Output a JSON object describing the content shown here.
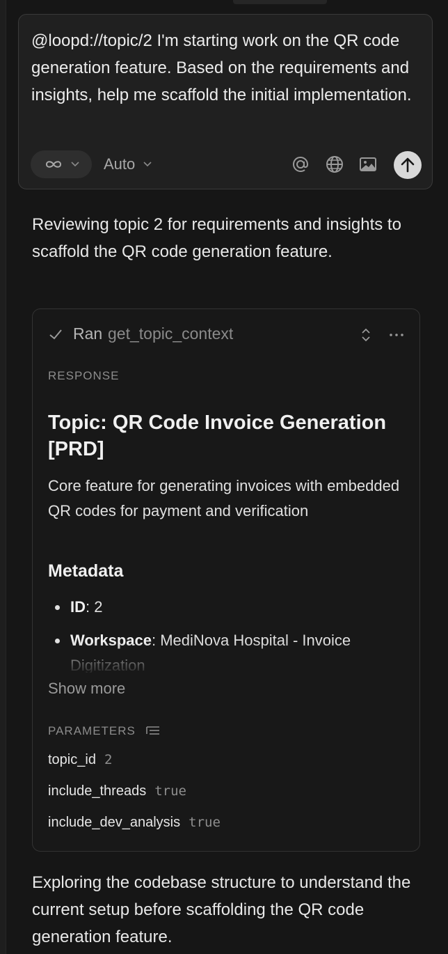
{
  "composer": {
    "message": "@loopd://topic/2 I'm starting work on the QR code generation feature. Based on the requirements and insights, help me scaffold the initial implementation.",
    "mode_icon": "infinity-icon",
    "model_label": "Auto",
    "icons": [
      "at-sign-icon",
      "globe-icon",
      "image-icon",
      "arrow-up-icon"
    ]
  },
  "intro_text": "Reviewing topic 2 for requirements and insights to scaffold the QR code generation feature.",
  "tool_call": {
    "status_label": "Ran",
    "tool_name": "get_topic_context",
    "response_label": "RESPONSE",
    "response": {
      "title": "Topic: QR Code Invoice Generation [PRD]",
      "description": "Core feature for generating invoices with embedded QR codes for payment and verification",
      "metadata_heading": "Metadata",
      "metadata": [
        {
          "key": "ID",
          "value": ": 2"
        },
        {
          "key": "Workspace",
          "value": ": MediNova Hospital - Invoice Digitization"
        }
      ]
    },
    "show_more_label": "Show more",
    "parameters_label": "PARAMETERS",
    "parameters": [
      {
        "key": "topic_id",
        "value": "2"
      },
      {
        "key": "include_threads",
        "value": "true"
      },
      {
        "key": "include_dev_analysis",
        "value": "true"
      }
    ]
  },
  "followup_text": "Exploring the codebase structure to understand the current setup before scaffolding the QR code generation feature."
}
